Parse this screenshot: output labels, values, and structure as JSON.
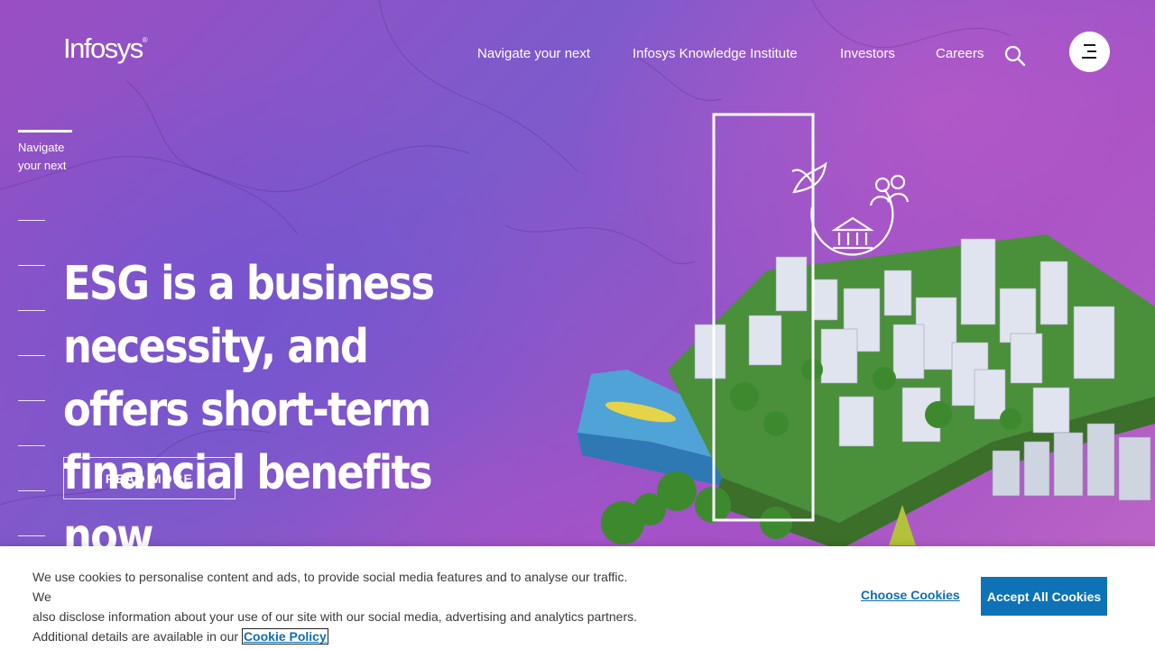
{
  "brand": {
    "logo_text": "Infosys",
    "logo_mark": "®"
  },
  "nav": {
    "links": [
      {
        "label": "Navigate your next"
      },
      {
        "label": "Infosys Knowledge Institute"
      },
      {
        "label": "Investors"
      },
      {
        "label": "Careers"
      }
    ],
    "search_icon": "search-icon",
    "menu_icon": "hamburger-menu-icon"
  },
  "side": {
    "label_line1": "Navigate",
    "label_line2": "your next",
    "slide_count": 8
  },
  "hero": {
    "headline_line1": "ESG is a business necessity, and",
    "headline_line2": "offers short-term financial benefits",
    "headline_line3": "now",
    "cta_label": "READ MORE"
  },
  "cookie_banner": {
    "text_line1": "We use cookies to personalise content and ads, to provide social media features and to analyse our traffic. We",
    "text_line2": "also disclose information about your use of our site with our social media, advertising and analytics partners.",
    "text_line3": "Additional details are available in our",
    "policy_link": "Cookie Policy",
    "choose_label": "Choose Cookies",
    "accept_label": "Accept All Cookies"
  },
  "colors": {
    "accent_blue": "#0e72b6",
    "link_blue": "#0e6fb0",
    "hero_purple": "#9a4ec3"
  }
}
